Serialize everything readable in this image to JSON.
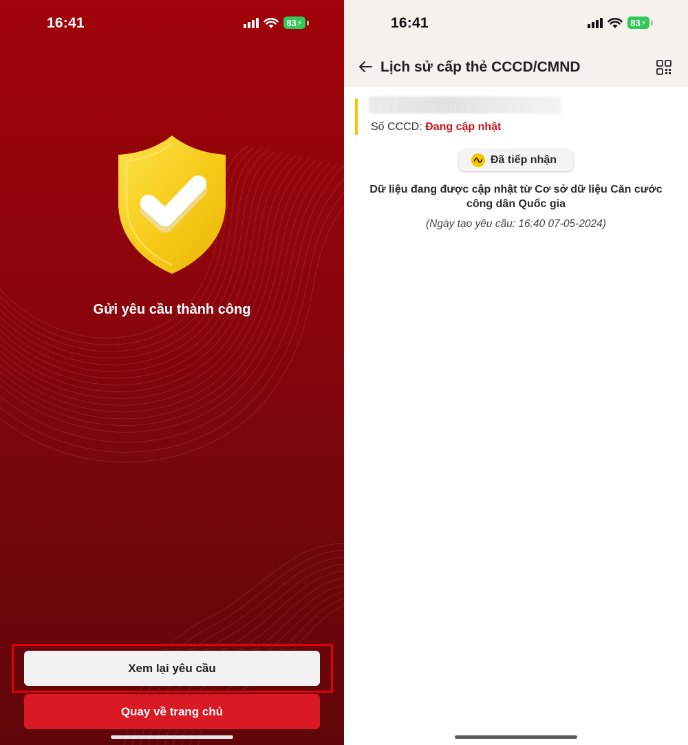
{
  "left_screen": {
    "status_bar": {
      "time": "16:41",
      "battery": "83"
    },
    "success_title": "Gửi yêu cầu thành công",
    "buttons": {
      "review_label": "Xem lại yêu cầu",
      "home_label": "Quay về trang chủ"
    },
    "colors": {
      "background": "#8e050c",
      "shield": "#f7cd1e",
      "home_button": "#d91923",
      "highlight": "#e1000f"
    }
  },
  "right_screen": {
    "status_bar": {
      "time": "16:41",
      "battery": "83"
    },
    "header": {
      "title": "Lịch sử cấp thẻ CCCD/CMND"
    },
    "record": {
      "id_label": "Số CCCD:",
      "id_value": "Đang cập nhật"
    },
    "status_badge": "Đã tiếp nhận",
    "info_text": "Dữ liệu đang được cập nhật từ Cơ sở dữ liệu Căn cước công dân Quốc gia",
    "request_date": "(Ngày tạo yêu cầu: 16:40 07-05-2024)",
    "colors": {
      "accent": "#f7c600",
      "id_value": "#c8141c",
      "header_bg": "#f5f2ee"
    }
  },
  "icons": [
    "shield-check-icon",
    "back-arrow-icon",
    "qr-code-icon",
    "status-wave-icon",
    "signal-icon",
    "wifi-icon",
    "battery-icon"
  ]
}
